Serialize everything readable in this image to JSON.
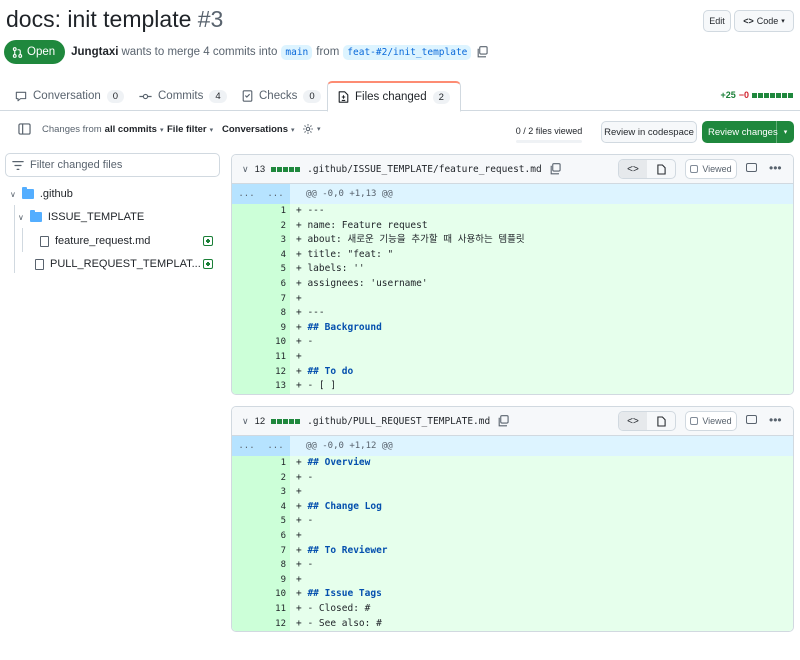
{
  "pr": {
    "title": "docs: init template",
    "number": "#3",
    "state": "Open",
    "author": "Jungtaxi",
    "merge_text": "wants to merge 4 commits into",
    "base_branch": "main",
    "from_text": "from",
    "head_branch": "feat-#2/init_template"
  },
  "header": {
    "edit_label": "Edit",
    "code_label": "Code"
  },
  "tabs": [
    {
      "label": "Conversation",
      "count": "0"
    },
    {
      "label": "Commits",
      "count": "4"
    },
    {
      "label": "Checks",
      "count": "0"
    },
    {
      "label": "Files changed",
      "count": "2"
    }
  ],
  "diffstat": {
    "additions": "+25",
    "deletions": "−0"
  },
  "toolbar": {
    "changes_from_prefix": "Changes from",
    "changes_from_value": "all commits",
    "file_filter": "File filter",
    "conversations": "Conversations",
    "files_viewed": "0 / 2 files viewed",
    "review_codespace": "Review in codespace",
    "review_changes": "Review changes"
  },
  "sidebar": {
    "filter_placeholder": "Filter changed files",
    "tree": {
      "root": ".github",
      "folder": "ISSUE_TEMPLATE",
      "file1": "feature_request.md",
      "file2": "PULL_REQUEST_TEMPLAT..."
    }
  },
  "diffs": [
    {
      "count": "13",
      "path": ".github/ISSUE_TEMPLATE/feature_request.md",
      "viewed_label": "Viewed",
      "hunk": "@@ -0,0 +1,13 @@",
      "lines": [
        {
          "n": "1",
          "text": "+ ---"
        },
        {
          "n": "2",
          "text": "+ name: Feature request"
        },
        {
          "n": "3",
          "text": "+ about: 새로운 기능을 추가할 때 사용하는 템플릿"
        },
        {
          "n": "4",
          "text": "+ title: \"feat: \""
        },
        {
          "n": "5",
          "text": "+ labels: ''"
        },
        {
          "n": "6",
          "text": "+ assignees: 'username'"
        },
        {
          "n": "7",
          "text": "+"
        },
        {
          "n": "8",
          "text": "+ ---"
        },
        {
          "n": "9",
          "text": "+ ## Background"
        },
        {
          "n": "10",
          "text": "+ -"
        },
        {
          "n": "11",
          "text": "+"
        },
        {
          "n": "12",
          "text": "+ ## To do"
        },
        {
          "n": "13",
          "text": "+ - [ ]"
        }
      ]
    },
    {
      "count": "12",
      "path": ".github/PULL_REQUEST_TEMPLATE.md",
      "viewed_label": "Viewed",
      "hunk": "@@ -0,0 +1,12 @@",
      "lines": [
        {
          "n": "1",
          "text": "+ ## Overview"
        },
        {
          "n": "2",
          "text": "+ -"
        },
        {
          "n": "3",
          "text": "+"
        },
        {
          "n": "4",
          "text": "+ ## Change Log"
        },
        {
          "n": "5",
          "text": "+ -"
        },
        {
          "n": "6",
          "text": "+"
        },
        {
          "n": "7",
          "text": "+ ## To Reviewer"
        },
        {
          "n": "8",
          "text": "+ -"
        },
        {
          "n": "9",
          "text": "+"
        },
        {
          "n": "10",
          "text": "+ ## Issue Tags"
        },
        {
          "n": "11",
          "text": "+ - Closed: #"
        },
        {
          "n": "12",
          "text": "+ - See also: #"
        }
      ]
    }
  ],
  "colors": {
    "accent_green": "#1f883d",
    "link_blue": "#0969da",
    "addition_bg": "#e6ffec"
  }
}
